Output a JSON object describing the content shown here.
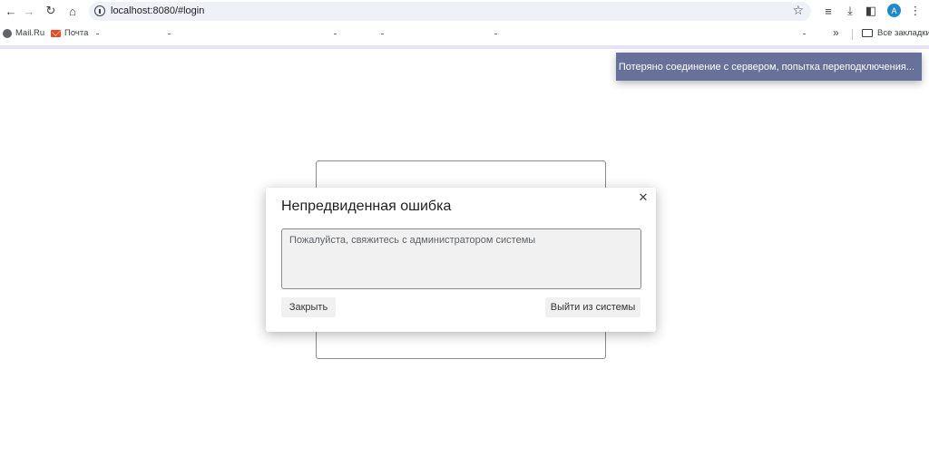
{
  "browser": {
    "url": "localhost:8080/#login",
    "bookmarks": [
      {
        "label": "Mail.Ru",
        "icon": "globe-icon"
      },
      {
        "label": "Почта",
        "icon": "mail-icon"
      }
    ],
    "all_bookmarks_label": "Все закладки",
    "profile_initial": "A"
  },
  "toast": {
    "message": "Потеряно соединение с сервером, попытка переподключения..."
  },
  "dialog": {
    "title": "Непредвиденная ошибка",
    "message": "Пожалуйста, свяжитесь с администратором системы",
    "close_button_label": "Закрыть",
    "logout_button_label": "Выйти из системы"
  }
}
